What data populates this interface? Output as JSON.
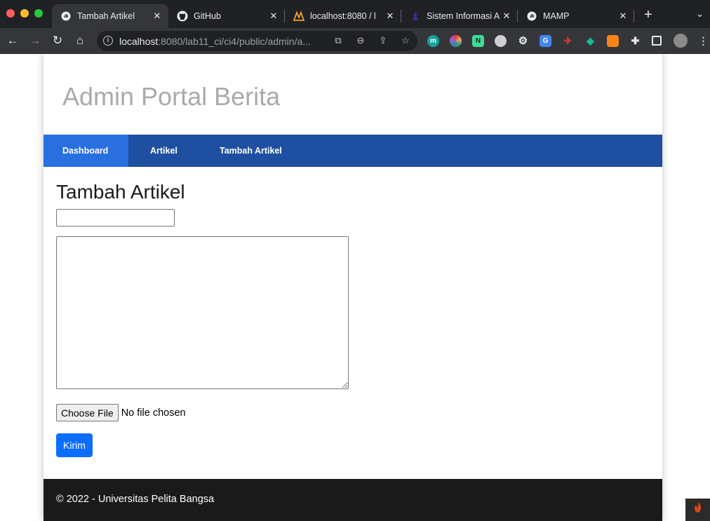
{
  "browser": {
    "tabs": [
      {
        "title": "Tambah Artikel",
        "icon": "mamp-elephant-icon",
        "active": true
      },
      {
        "title": "GitHub",
        "icon": "github-icon",
        "active": false
      },
      {
        "title": "localhost:8080 / l",
        "icon": "phpmyadmin-icon",
        "active": false
      },
      {
        "title": "Sistem Informasi A",
        "icon": "university-icon",
        "active": false
      },
      {
        "title": "MAMP",
        "icon": "mamp-elephant-icon",
        "active": false
      }
    ],
    "address": {
      "host": "localhost",
      "path": ":8080/lab11_ci/ci4/public/admin/a..."
    }
  },
  "page": {
    "site_title": "Admin Portal Berita",
    "nav": [
      {
        "label": "Dashboard",
        "active": true
      },
      {
        "label": "Artikel",
        "active": false
      },
      {
        "label": "Tambah Artikel",
        "active": false
      }
    ],
    "heading": "Tambah Artikel",
    "form": {
      "title_value": "",
      "body_value": "",
      "file_button_label": "Choose File",
      "file_status": "No file chosen",
      "submit_label": "Kirim"
    },
    "footer": "© 2022 - Universitas Pelita Bangsa"
  },
  "colors": {
    "nav_bg": "#1e4fa0",
    "nav_active_bg": "#2a6fe0",
    "submit_bg": "#0d6efd",
    "footer_bg": "#1a1a1a"
  }
}
